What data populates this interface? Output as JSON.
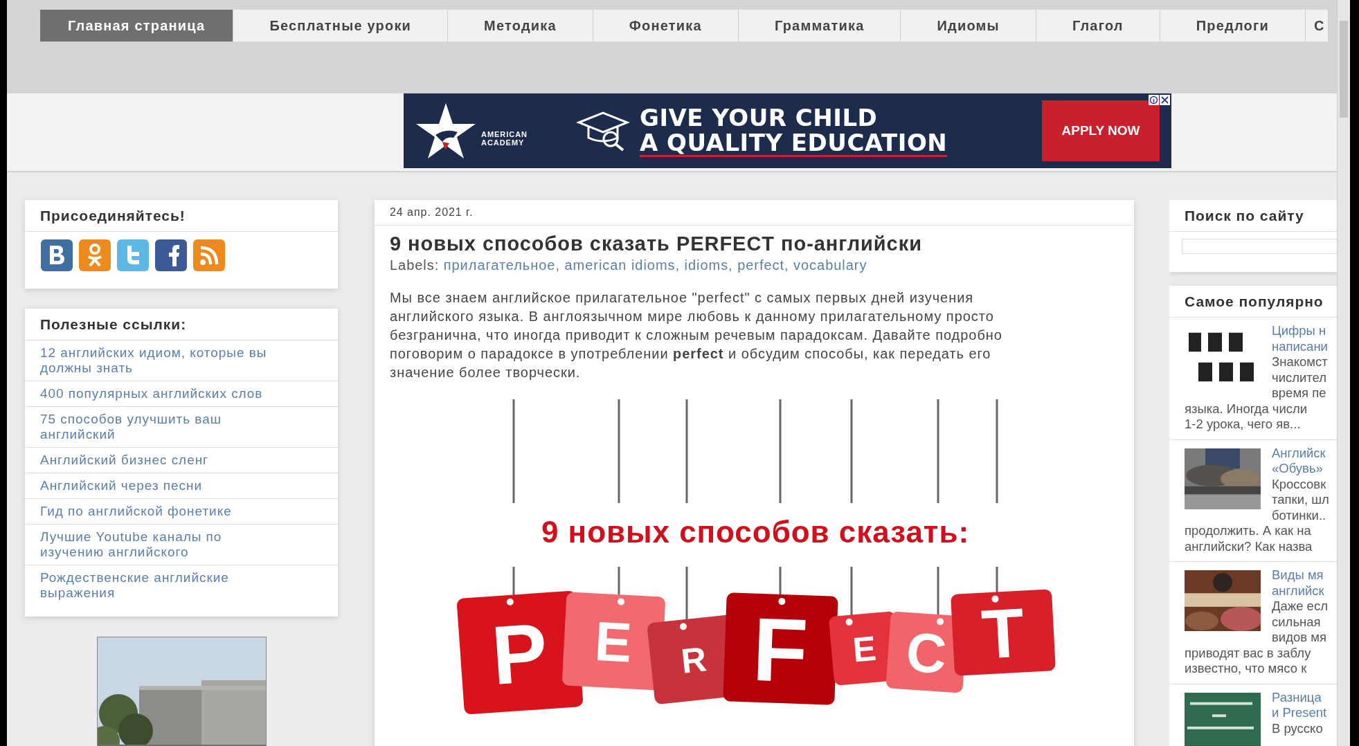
{
  "nav": {
    "tabs": [
      {
        "label": "Главная страница",
        "selected": true
      },
      {
        "label": "Бесплатные уроки",
        "selected": false
      },
      {
        "label": "Методика",
        "selected": false
      },
      {
        "label": "Фонетика",
        "selected": false
      },
      {
        "label": "Грамматика",
        "selected": false
      },
      {
        "label": "Идиомы",
        "selected": false
      },
      {
        "label": "Глагол",
        "selected": false
      },
      {
        "label": "Предлоги",
        "selected": false
      },
      {
        "label": "С",
        "selected": false
      }
    ]
  },
  "ad": {
    "logo_lines": [
      "AMERICAN",
      "ACADEMY"
    ],
    "headline_lines": [
      "GIVE YOUR CHILD",
      "A QUALITY EDUCATION"
    ],
    "button": "APPLY NOW"
  },
  "left_sidebar": {
    "join": {
      "title": "Присоединяйтесь!",
      "social": [
        {
          "kind": "vk"
        },
        {
          "kind": "ok"
        },
        {
          "kind": "twitter"
        },
        {
          "kind": "facebook"
        },
        {
          "kind": "rss"
        }
      ]
    },
    "links": {
      "title": "Полезные ссылки:",
      "items": [
        "12 английских идиом, которые вы должны знать",
        "400 популярных английских слов",
        "75 способов улучшить ваш английский",
        "Английский бизнес сленг",
        "Английский через песни",
        "Гид по английской фонетике",
        "Лучшие Youtube каналы по изучению английского",
        "Рождественские английские выражения"
      ]
    },
    "photo": {
      "kind": "picture"
    }
  },
  "post": {
    "date": "24 апр. 2021 г.",
    "title": "9 новых способов сказать PERFECT по-английски",
    "labels_prefix": "Labels:",
    "labels": [
      "прилагательное,",
      "american idioms,",
      "idioms,",
      "perfect,",
      "vocabulary"
    ],
    "body": "Мы все знаем английское прилагательное \"perfect\" с самых первых дней изучения английского языка. В англоязычном мире любовь к данному прилагательному просто безгранична, что иногда приводит к сложным речевым парадоксам. Давайте подробно поговорим о парадоксе в употреблении **perfect** и обсудим способы, как передать его значение более творчески.",
    "image": {
      "caption": "9 новых способов сказать:",
      "letters": [
        "P",
        "E",
        "R",
        "F",
        "E",
        "C",
        "T"
      ]
    }
  },
  "right_sidebar": {
    "search": {
      "title": "Поиск по сайту"
    },
    "popular": {
      "title": "Самое популярно",
      "posts": [
        {
          "thumb": {
            "kind": "picture"
          },
          "title_lines": [
            "Цифры н",
            "написани"
          ],
          "text_lines": [
            "Знакомст",
            "числител",
            "время пе"
          ],
          "more_lines": [
            "языка. Иногда числи",
            "1-2 урока, чего яв..."
          ]
        },
        {
          "thumb": {
            "kind": "picture"
          },
          "title_lines": [
            "Английск",
            "«Обувь»"
          ],
          "text_lines": [
            "Кроссовк",
            "тапки, шл",
            "ботинки.."
          ],
          "more_lines": [
            "продолжить. А как на",
            "английски? Как назва"
          ]
        },
        {
          "thumb": {
            "kind": "picture"
          },
          "title_lines": [
            "Виды мя",
            "английск"
          ],
          "text_lines": [
            "Даже есл",
            "сильная",
            "видов мя"
          ],
          "more_lines": [
            "приводят вас в заблу",
            "известно, что мясо к"
          ]
        },
        {
          "thumb": {
            "kind": "picture"
          },
          "title_lines": [
            "Разница",
            "и Present"
          ],
          "text_lines": [
            "В русско"
          ]
        }
      ]
    }
  }
}
